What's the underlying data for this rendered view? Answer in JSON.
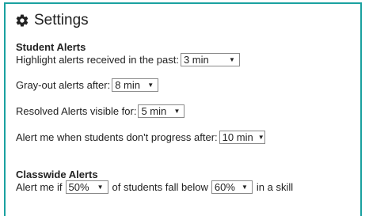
{
  "settings": {
    "title": "Settings",
    "icon": "gear-icon"
  },
  "student_alerts": {
    "title": "Student Alerts",
    "highlight_label": "Highlight alerts received in the past:",
    "highlight_value": "3 min",
    "grayout_label": "Gray-out alerts after:",
    "grayout_value": "8 min",
    "resolved_label": "Resolved Alerts visible for:",
    "resolved_value": "5 min",
    "progress_label": "Alert me when students don't progress after:",
    "progress_value": "10 min"
  },
  "classwide_alerts": {
    "title": "Classwide Alerts",
    "prefix": "Alert me if",
    "percent_value": "50%",
    "middle": "of students fall below",
    "threshold_value": "60%",
    "suffix": "in a skill"
  },
  "colors": {
    "border": "#1aa1a0"
  }
}
